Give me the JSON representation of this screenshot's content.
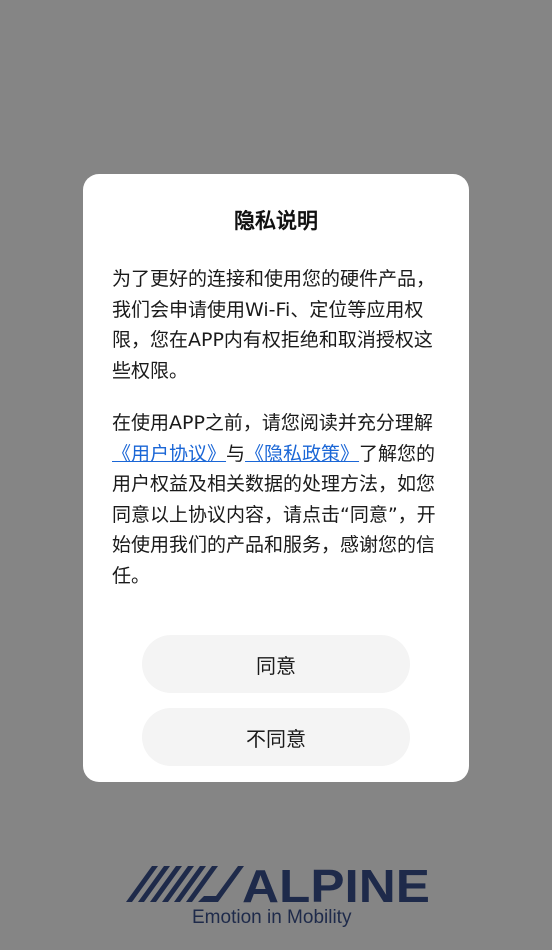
{
  "dialog": {
    "title": "隐私说明",
    "paragraph1": "为了更好的连接和使用您的硬件产品，我们会申请使用Wi-Fi、定位等应用权限，您在APP内有权拒绝和取消授权这些权限。",
    "paragraph2": {
      "before": "在使用APP之前，请您阅读并充分理解",
      "user_agreement_link": "《用户协议》",
      "and": "与",
      "privacy_policy_link": "《隐私政策》",
      "after": "了解您的用户权益及相关数据的处理方法，如您同意以上协议内容，请点击“同意”，开始使用我们的产品和服务，感谢您的信任。"
    },
    "agree_label": "同意",
    "disagree_label": "不同意"
  },
  "brand": {
    "logo_text": "ALPINE",
    "tagline": "Emotion in Mobility",
    "color": "#1e2a4a"
  },
  "colors": {
    "overlay": "#858585",
    "link": "#1a66d6",
    "button_bg": "#f4f4f4"
  }
}
